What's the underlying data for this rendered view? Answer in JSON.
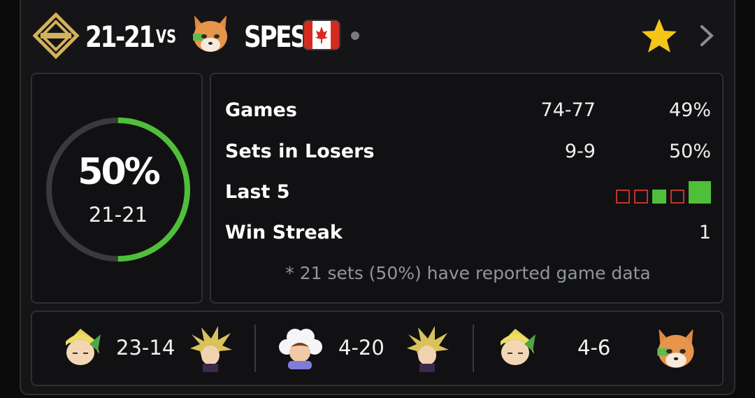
{
  "header": {
    "player1_name": "21-21",
    "vs_label": "VS",
    "player2_name": "SPES",
    "team_logo_icon": "team-diamond-logo-icon",
    "player2_character_icon": "fox-icon",
    "flag_icon": "canada-flag-icon",
    "favorite_icon": "star-icon",
    "open_icon": "chevron-right-icon"
  },
  "ring": {
    "percent_label": "50%",
    "record": "21-21",
    "win_fraction": 0.5,
    "colors": {
      "win": "#4fbf3a",
      "track": "#3a3a3d"
    }
  },
  "stats": {
    "games": {
      "label": "Games",
      "record": "74-77",
      "percent": "49%"
    },
    "losers": {
      "label": "Sets in Losers",
      "record": "9-9",
      "percent": "50%"
    },
    "last5": {
      "label": "Last 5",
      "results": [
        "L",
        "L",
        "W",
        "L",
        "W"
      ]
    },
    "streak": {
      "label": "Win Streak",
      "value": "1"
    },
    "footnote": "* 21 sets (50%) have reported game data"
  },
  "matchups": [
    {
      "left_icon": "toon-link-icon",
      "record": "23-14",
      "right_icon": "cloud-icon"
    },
    {
      "left_icon": "ice-climbers-icon",
      "record": "4-20",
      "right_icon": "cloud-icon"
    },
    {
      "left_icon": "toon-link-icon",
      "record": "4-6",
      "right_icon": "fox-icon"
    }
  ],
  "colors": {
    "accent_green": "#4fbf3a",
    "loss_red": "#c1342c",
    "star_gold": "#f5c518"
  }
}
